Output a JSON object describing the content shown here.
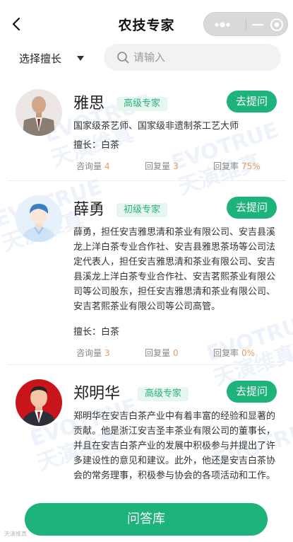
{
  "header": {
    "title": "农技专家",
    "back_icon": "chevron-left-icon"
  },
  "capsule": {
    "more_icon": "more-dots-icon",
    "minimize_icon": "minimize-icon",
    "close_icon": "target-close-icon"
  },
  "filter": {
    "label": "选择擅长"
  },
  "search": {
    "placeholder": "请输入",
    "value": ""
  },
  "stats_labels": {
    "consult": "咨询量",
    "reply": "回复量",
    "rate": "回复率"
  },
  "experts": [
    {
      "name": "雅思",
      "level": "高级专家",
      "ask_label": "去提问",
      "desc": "国家级茶艺师、国家级非遗制茶工艺大师",
      "skill": "擅长：白茶",
      "consult": "4",
      "reply": "3",
      "rate": "75%"
    },
    {
      "name": "薛勇",
      "level": "初级专家",
      "ask_label": "去提问",
      "desc": "薛勇，担任安吉雅思清和茶业有限公司、安吉县溪龙上洋白茶专业合作社、安吉县雅思茶场等公司法定代表人，担任安吉雅思清和茶业有限公司、安吉县溪龙上洋白茶专业合作社、安吉茗熙茶业有限公司等公司股东，担任安吉雅思清和茶业有限公司、安吉茗熙茶业有限公司等公司高管。",
      "skill": "擅长：白茶",
      "consult": "3",
      "reply": "0",
      "rate": "0%"
    },
    {
      "name": "郑明华",
      "level": "高级专家",
      "ask_label": "去提问",
      "desc": "郑明华在安吉白茶产业中有着丰富的经验和显著的贡献。他是浙江安吉圣丰茶业有限公司的董事长，并且在安吉白茶产业的发展中积极参与并提出了许多建设性的意见和建议。此外，他还是安吉白茶协会的常务理事，积极参与协会的各项活动和工作。"
    }
  ],
  "watermark": {
    "en": "EVOTRUE",
    "cn": "天演维真"
  },
  "footer": {
    "qa_label": "问答库",
    "corner_text": "天演维真"
  },
  "colors": {
    "accent": "#1fb37c",
    "level_bg": "#e6f7ef",
    "stat_value": "#e6a062"
  }
}
